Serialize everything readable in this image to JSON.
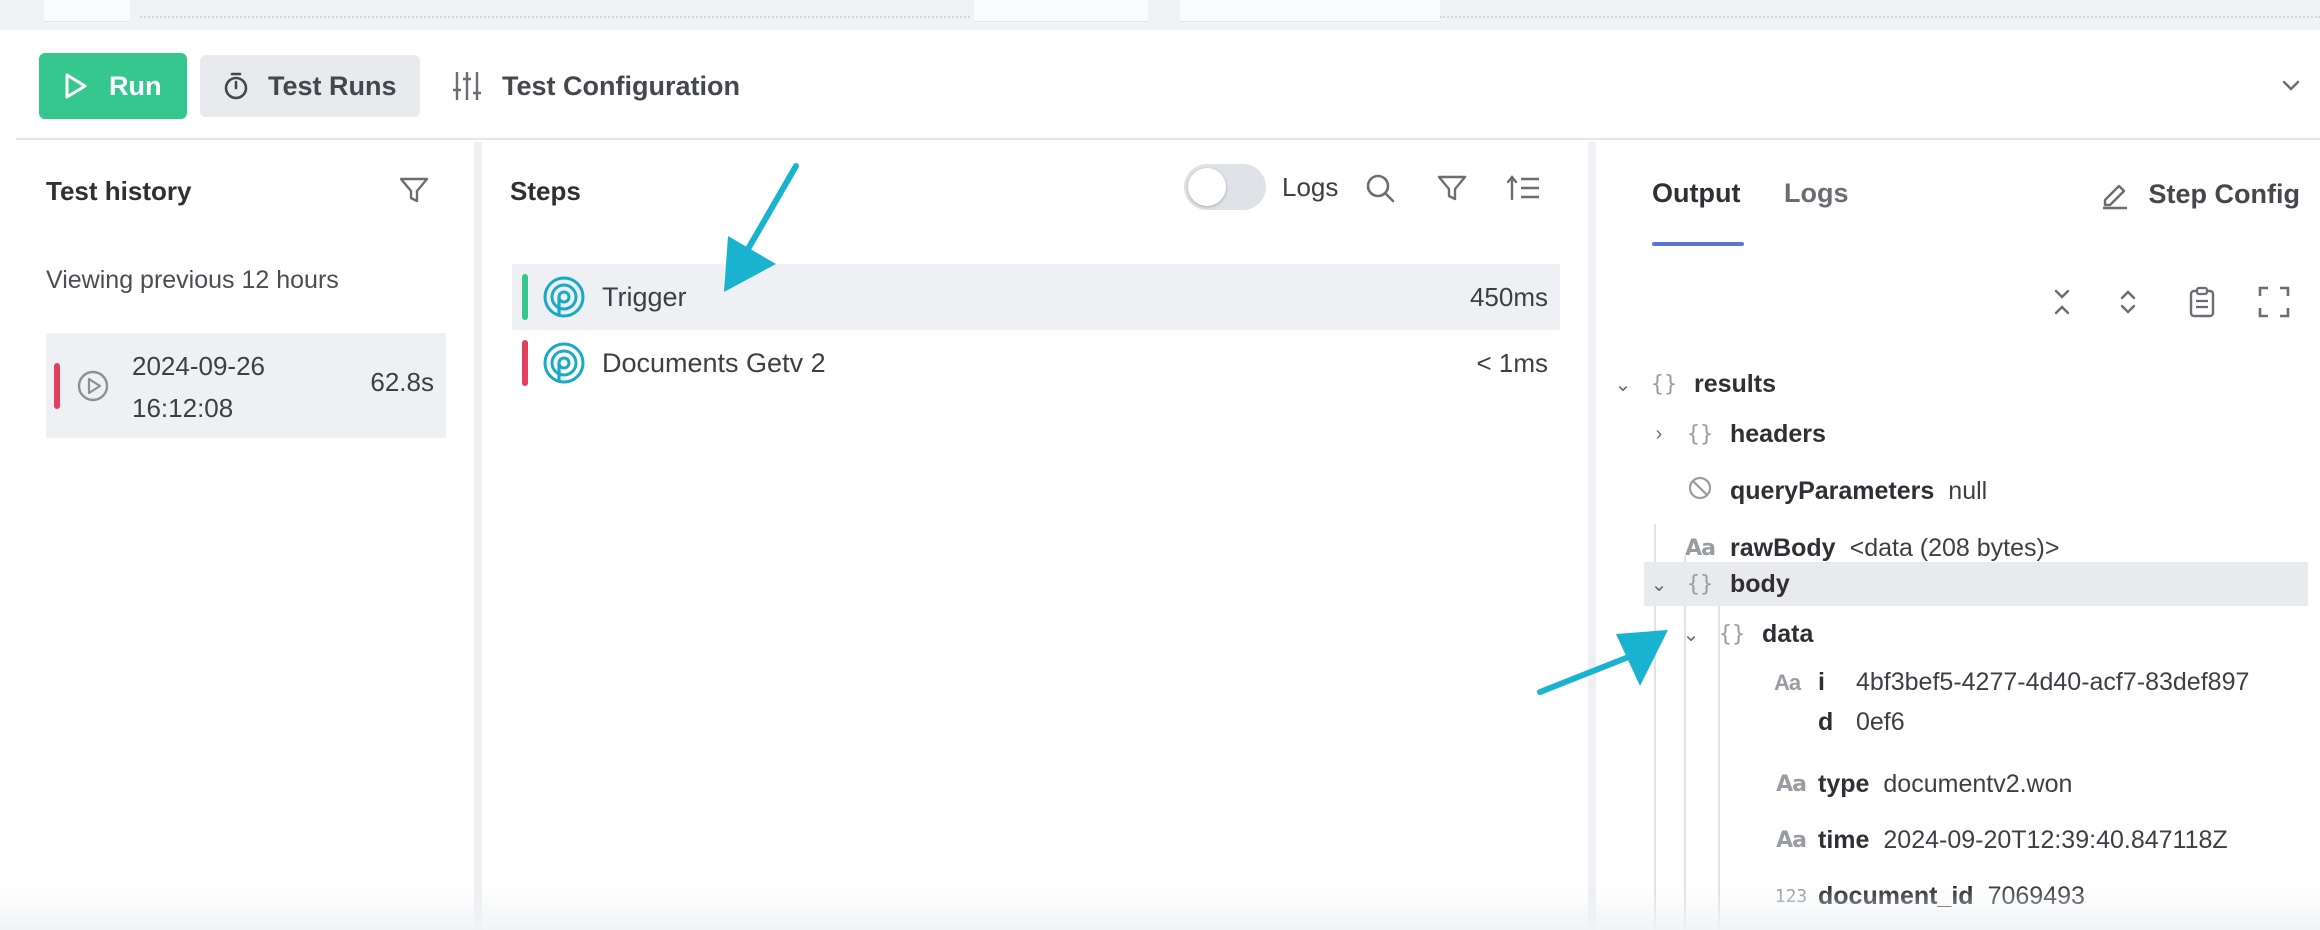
{
  "toolbar": {
    "run_label": "Run",
    "test_runs_label": "Test Runs",
    "test_config_label": "Test Configuration"
  },
  "history": {
    "title": "Test history",
    "range_text": "Viewing previous 12 hours",
    "items": [
      {
        "date": "2024-09-26",
        "time": "16:12:08",
        "duration": "62.8s",
        "status_color": "#e2405f"
      }
    ]
  },
  "steps": {
    "title": "Steps",
    "logs_toggle_label": "Logs",
    "items": [
      {
        "name": "Trigger",
        "duration": "450ms",
        "status_color": "#35c78e",
        "selected": true
      },
      {
        "name": "Documents Getv 2",
        "duration": "< 1ms",
        "status_color": "#e2405f",
        "selected": false
      }
    ]
  },
  "output": {
    "tabs": [
      "Output",
      "Logs"
    ],
    "active_tab": "Output",
    "step_config_label": "Step Config",
    "tree": {
      "results": "results",
      "headers": "headers",
      "queryParameters": {
        "key": "queryParameters",
        "value": "null"
      },
      "rawBody": {
        "key": "rawBody",
        "value": "<data (208 bytes)>"
      },
      "body": "body",
      "data": "data",
      "id": {
        "key_line1": "i",
        "key_line2": "d",
        "value_line1": "4bf3bef5-4277-4d40-acf7-83def897",
        "value_line2": "0ef6"
      },
      "type": {
        "key": "type",
        "value": "documentv2.won"
      },
      "time": {
        "key": "time",
        "value": "2024-09-20T12:39:40.847118Z"
      },
      "document_id": {
        "key": "document_id",
        "value": "7069493"
      }
    }
  },
  "colors": {
    "accent": "#5b73d6",
    "run_green": "#35c78e",
    "error_red": "#e2405f",
    "arrow_cyan": "#19b3cf",
    "step_logo": "#1aa9c9"
  }
}
